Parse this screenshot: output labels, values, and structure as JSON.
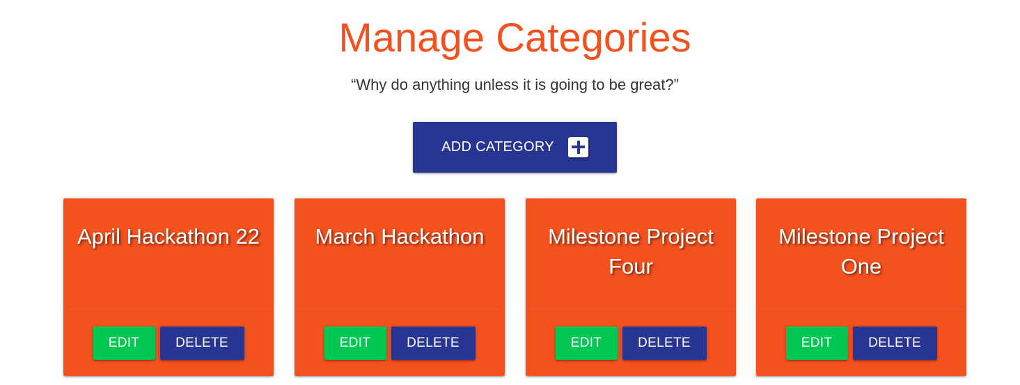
{
  "header": {
    "title": "Manage Categories",
    "quote": "“Why do anything unless it is going to be great?”"
  },
  "add_button": {
    "label": "ADD CATEGORY",
    "icon": "plus-box-icon"
  },
  "colors": {
    "accent": "#f4511e",
    "primary": "#283593",
    "success": "#00c853"
  },
  "categories": [
    {
      "name": "April Hackathon 22",
      "edit_label": "EDIT",
      "delete_label": "DELETE"
    },
    {
      "name": "March Hackathon",
      "edit_label": "EDIT",
      "delete_label": "DELETE"
    },
    {
      "name": "Milestone Project Four",
      "edit_label": "EDIT",
      "delete_label": "DELETE"
    },
    {
      "name": "Milestone Project One",
      "edit_label": "EDIT",
      "delete_label": "DELETE"
    }
  ]
}
